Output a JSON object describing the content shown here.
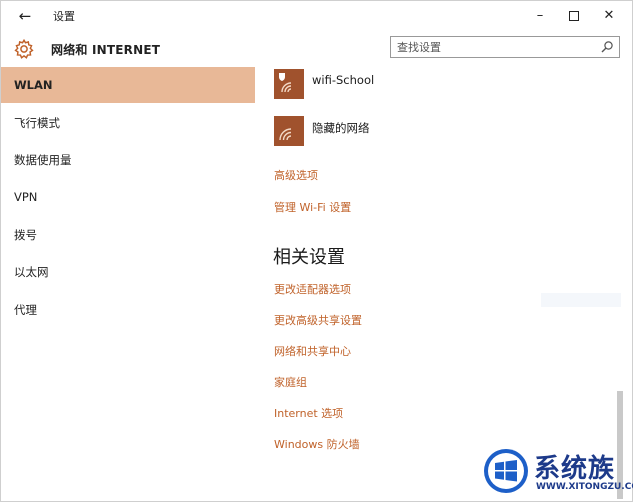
{
  "window": {
    "title": "设置",
    "back_glyph": "←",
    "minimize_glyph": "–",
    "close_glyph": "✕"
  },
  "header": {
    "title": "网络和 INTERNET",
    "search_placeholder": "查找设置"
  },
  "sidebar": {
    "items": [
      {
        "label": "WLAN"
      },
      {
        "label": "飞行模式"
      },
      {
        "label": "数据使用量"
      },
      {
        "label": "VPN"
      },
      {
        "label": "拨号"
      },
      {
        "label": "以太网"
      },
      {
        "label": "代理"
      }
    ]
  },
  "main": {
    "networks": [
      {
        "name": "wifi-School",
        "secured": true
      },
      {
        "name": "隐藏的网络",
        "secured": false
      }
    ],
    "links_top": [
      "高级选项",
      "管理 Wi-Fi 设置"
    ],
    "related_heading": "相关设置",
    "related_links": [
      "更改适配器选项",
      "更改高级共享设置",
      "网络和共享中心",
      "家庭组",
      "Internet 选项",
      "Windows 防火墙"
    ]
  },
  "watermark": {
    "text": "系统族",
    "url": "WWW.XITONGZU.COM"
  },
  "colors": {
    "accent": "#e8b897",
    "link": "#c0622a",
    "wifi_tile": "#a0522d"
  }
}
